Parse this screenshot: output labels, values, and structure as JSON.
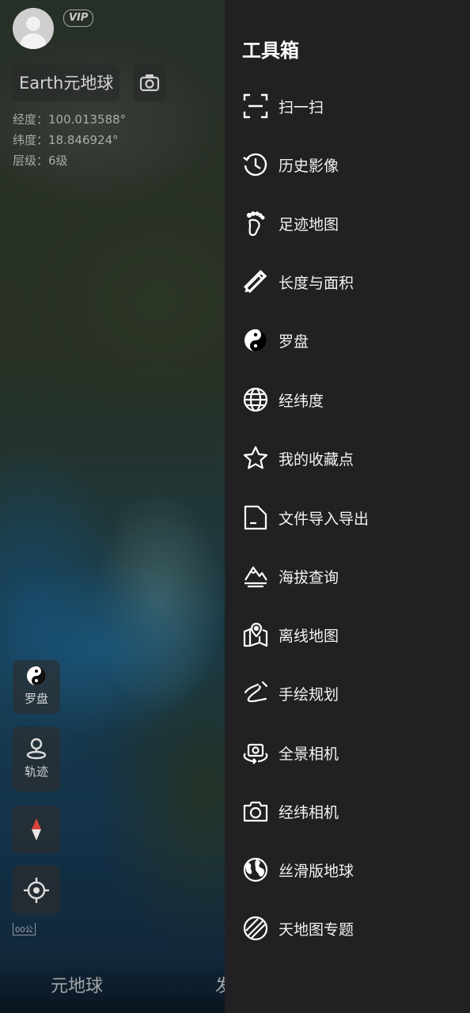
{
  "map": {
    "vip_label": "VIP",
    "title": "Earth元地球",
    "coords": {
      "longitude": "经度：100.013588°",
      "latitude": "纬度：18.846924°",
      "level": "层级：6级"
    },
    "side_buttons": {
      "compass_label": "罗盘",
      "track_label": "轨迹"
    },
    "scale_text": "00公",
    "bottom_tabs": [
      "元地球",
      "发"
    ]
  },
  "drawer": {
    "title": "工具箱",
    "items": [
      {
        "label": "扫一扫",
        "icon": "scan-icon"
      },
      {
        "label": "历史影像",
        "icon": "history-clock-icon"
      },
      {
        "label": "足迹地图",
        "icon": "footprint-icon"
      },
      {
        "label": "长度与面积",
        "icon": "ruler-pencil-icon"
      },
      {
        "label": "罗盘",
        "icon": "yin-yang-icon"
      },
      {
        "label": "经纬度",
        "icon": "globe-grid-icon"
      },
      {
        "label": "我的收藏点",
        "icon": "star-icon"
      },
      {
        "label": "文件导入导出",
        "icon": "file-icon"
      },
      {
        "label": "海拔查询",
        "icon": "mountain-icon"
      },
      {
        "label": "离线地图",
        "icon": "offline-map-icon"
      },
      {
        "label": "手绘规划",
        "icon": "hand-draw-icon"
      },
      {
        "label": "全景相机",
        "icon": "panorama-camera-icon"
      },
      {
        "label": "经纬相机",
        "icon": "camera-icon"
      },
      {
        "label": "丝滑版地球",
        "icon": "earth-icon"
      },
      {
        "label": "天地图专题",
        "icon": "tianditu-icon"
      }
    ]
  },
  "colors": {
    "drawer_bg": "#212124",
    "text": "#f2f2f2"
  }
}
